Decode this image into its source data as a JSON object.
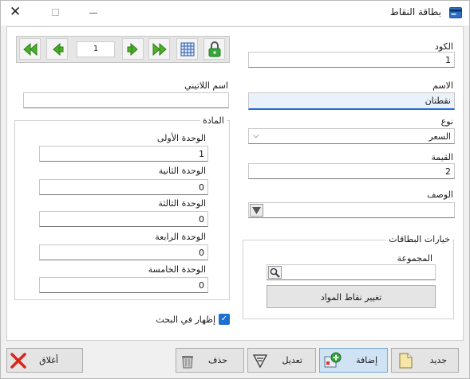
{
  "window": {
    "title": "بطاقة النقاط",
    "close_glyph": "✕",
    "app_icon": "card-icon"
  },
  "nav": {
    "record_number": "1",
    "icons": [
      "first-record-icon",
      "prev-record-icon",
      "next-record-icon",
      "last-record-icon",
      "grid-icon",
      "lock-icon"
    ]
  },
  "form": {
    "code": {
      "label": "الكود",
      "value": "1"
    },
    "name": {
      "label": "الاسم",
      "value": "نقطتان"
    },
    "latin_name": {
      "label": "اسم اللاتيني",
      "value": ""
    },
    "type": {
      "label": "نوع",
      "value": "السعر"
    },
    "value": {
      "label": "القيمة",
      "value": "2"
    },
    "description": {
      "label": "الوصف",
      "value": ""
    }
  },
  "material": {
    "title": "المادة",
    "units": [
      {
        "label": "الوحدة الأولى",
        "value": "1"
      },
      {
        "label": "الوحدة الثانية",
        "value": "0"
      },
      {
        "label": "الوحدة الثالثة",
        "value": "0"
      },
      {
        "label": "الوحدة الرابعة",
        "value": "0"
      },
      {
        "label": "الوحدة الخامسة",
        "value": "0"
      }
    ]
  },
  "card_options": {
    "title": "خيارات البطاقات",
    "group_label": "المجموعة",
    "group_value": "",
    "change_points_button": "تغيير نقاط المواد"
  },
  "show_in_search": {
    "label": "إظهار في البحث",
    "checked": true
  },
  "buttons": {
    "new": "جديد",
    "add": "إضافة",
    "edit": "تعديل",
    "delete": "حذف",
    "close": "أغلاق"
  },
  "colors": {
    "accent": "#1f6fcf",
    "nav_green": "#4caf2a",
    "close_red": "#d9261c"
  }
}
